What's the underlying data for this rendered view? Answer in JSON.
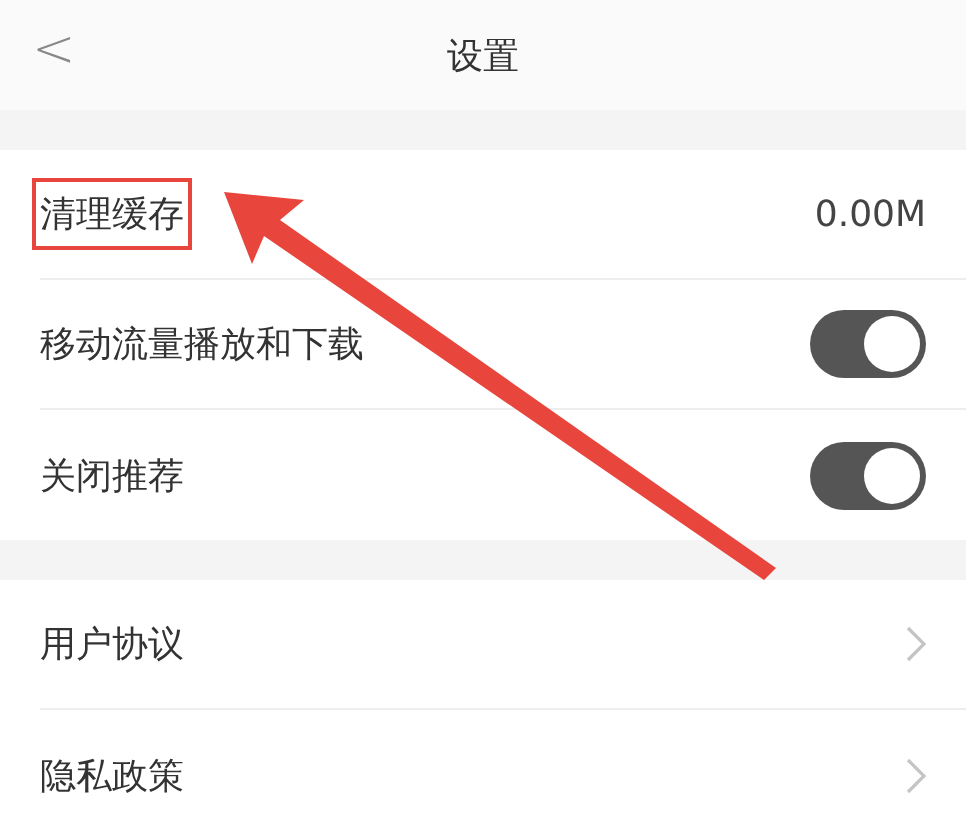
{
  "header": {
    "back": "<",
    "title": "设置"
  },
  "groups": [
    {
      "rows": [
        {
          "kind": "value",
          "label": "清理缓存",
          "value": "0.00M",
          "highlighted": true
        },
        {
          "kind": "toggle",
          "label": "移动流量播放和下载",
          "on": true
        },
        {
          "kind": "toggle",
          "label": "关闭推荐",
          "on": true
        }
      ]
    },
    {
      "rows": [
        {
          "kind": "link",
          "label": "用户协议"
        },
        {
          "kind": "link",
          "label": "隐私政策"
        }
      ]
    }
  ]
}
